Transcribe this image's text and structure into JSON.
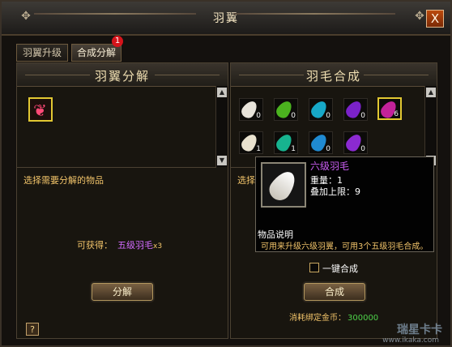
{
  "window": {
    "title": "羽翼",
    "close_label": "X"
  },
  "tabs": [
    {
      "label": "羽翼升级",
      "active": false
    },
    {
      "label": "合成分解",
      "active": true,
      "badge": "1"
    }
  ],
  "left_panel": {
    "title": "羽翼分解",
    "hint": "选择需要分解的物品",
    "gain_label": "可获得：",
    "gain_item": "五级羽毛",
    "gain_count": "x3",
    "button": "分解",
    "help": "?"
  },
  "right_panel": {
    "title": "羽毛合成",
    "hint_partial": "选择需",
    "feathers": [
      {
        "color": "#e7e3da",
        "count": "0"
      },
      {
        "color": "#4bb31f",
        "count": "0"
      },
      {
        "color": "#17a8c8",
        "count": "0"
      },
      {
        "color": "#7a22c9",
        "count": "0"
      },
      {
        "color": "#c2229a",
        "count": "6",
        "selected": true
      },
      {
        "color": "#e9e2cf",
        "count": "1"
      },
      {
        "color": "#17b38f",
        "count": "1"
      },
      {
        "color": "#1f8ad1",
        "count": "0"
      },
      {
        "color": "#8b2ad1",
        "count": "0"
      }
    ],
    "one_click_label": "一键合成",
    "button": "合成",
    "cost_label": "消耗绑定金币：",
    "cost_value": "300000"
  },
  "tooltip": {
    "name": "六级羽毛",
    "weight": "重量：1",
    "stack": "叠加上限：9",
    "desc_label": "物品说明",
    "desc": "可用来升级六级羽翼，可用3个五级羽毛合成。"
  },
  "watermark": {
    "text": "瑞星卡卡",
    "url": "www.ikaka.com"
  }
}
